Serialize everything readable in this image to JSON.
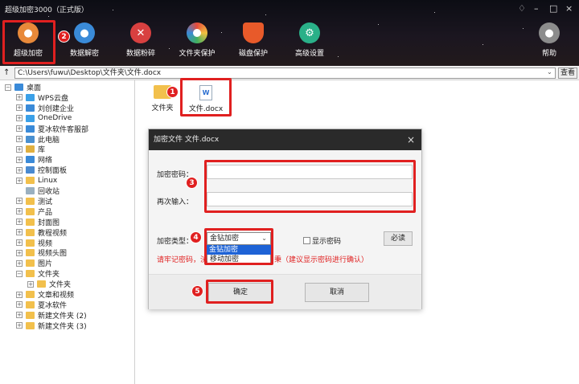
{
  "window": {
    "title": "超级加密3000（正式版）",
    "controls": [
      "–",
      "□",
      "×"
    ]
  },
  "toolbar": {
    "items": [
      {
        "label": "超级加密",
        "icon": "lock-icon",
        "color": "#e8893a"
      },
      {
        "label": "数据解密",
        "icon": "unlock-icon",
        "color": "#3a8ad8"
      },
      {
        "label": "数据粉碎",
        "icon": "scissors-icon",
        "color": "#d84040"
      },
      {
        "label": "文件夹保护",
        "icon": "folder-protect-icon",
        "color": "#e0c040"
      },
      {
        "label": "磁盘保护",
        "icon": "shield-icon",
        "color": "#e85a2a"
      },
      {
        "label": "高级设置",
        "icon": "gear-icon",
        "color": "#2ab088"
      },
      {
        "label": "帮助",
        "icon": "user-icon",
        "color": "#8c8c8c"
      }
    ]
  },
  "address": {
    "path": "C:\\Users\\fuwu\\Desktop\\文件夹\\文件.docx",
    "view_button": "查看"
  },
  "tree": [
    {
      "label": "桌面",
      "depth": 0,
      "expander": "−",
      "icon": "desktop-icon"
    },
    {
      "label": "WPS云盘",
      "depth": 1,
      "expander": "+",
      "icon": "cloud-icon"
    },
    {
      "label": "刘创建企业",
      "depth": 1,
      "expander": "+",
      "icon": "user-icon"
    },
    {
      "label": "OneDrive",
      "depth": 1,
      "expander": "+",
      "icon": "cloud-icon"
    },
    {
      "label": "夏冰软件客服部",
      "depth": 1,
      "expander": "+",
      "icon": "user-icon"
    },
    {
      "label": "此电脑",
      "depth": 1,
      "expander": "+",
      "icon": "computer-icon"
    },
    {
      "label": "库",
      "depth": 1,
      "expander": "+",
      "icon": "library-icon"
    },
    {
      "label": "网络",
      "depth": 1,
      "expander": "+",
      "icon": "network-icon"
    },
    {
      "label": "控制面板",
      "depth": 1,
      "expander": "+",
      "icon": "control-panel-icon"
    },
    {
      "label": "Linux",
      "depth": 1,
      "expander": "+",
      "icon": "folder-icon"
    },
    {
      "label": "回收站",
      "depth": 1,
      "expander": "",
      "icon": "recycle-bin-icon"
    },
    {
      "label": "测试",
      "depth": 1,
      "expander": "+",
      "icon": "folder-icon"
    },
    {
      "label": "产品",
      "depth": 1,
      "expander": "+",
      "icon": "folder-icon"
    },
    {
      "label": "封面图",
      "depth": 1,
      "expander": "+",
      "icon": "folder-icon"
    },
    {
      "label": "教程视频",
      "depth": 1,
      "expander": "+",
      "icon": "folder-icon"
    },
    {
      "label": "视频",
      "depth": 1,
      "expander": "+",
      "icon": "folder-icon"
    },
    {
      "label": "视频头图",
      "depth": 1,
      "expander": "+",
      "icon": "folder-icon"
    },
    {
      "label": "图片",
      "depth": 1,
      "expander": "+",
      "icon": "folder-icon"
    },
    {
      "label": "文件夹",
      "depth": 1,
      "expander": "−",
      "icon": "folder-icon"
    },
    {
      "label": "文件夹",
      "depth": 2,
      "expander": "+",
      "icon": "folder-icon"
    },
    {
      "label": "文章和视频",
      "depth": 1,
      "expander": "+",
      "icon": "folder-icon"
    },
    {
      "label": "夏冰软件",
      "depth": 1,
      "expander": "+",
      "icon": "folder-icon"
    },
    {
      "label": "新建文件夹 (2)",
      "depth": 1,
      "expander": "+",
      "icon": "folder-icon"
    },
    {
      "label": "新建文件夹 (3)",
      "depth": 1,
      "expander": "+",
      "icon": "folder-icon"
    }
  ],
  "files": [
    {
      "label": "文件夹",
      "icon": "folder-icon"
    },
    {
      "label": "文件.docx",
      "icon": "word-doc-icon",
      "icon_text": "W"
    }
  ],
  "dialog": {
    "title": "加密文件 文件.docx",
    "password_label": "加密密码：",
    "confirm_label": "再次输入：",
    "type_label": "加密类型：",
    "selected_type": "金钻加密",
    "options": [
      "金钻加密",
      "移动加密"
    ],
    "show_password": "显示密码",
    "must_read": "必读",
    "warning_left": "请牢记密码，洸",
    "warning_right": "秉（建议显示密码进行确认）",
    "ok": "确定",
    "cancel": "取消"
  },
  "markers": [
    "1",
    "2",
    "3",
    "4",
    "5"
  ],
  "accent": "#e02020"
}
